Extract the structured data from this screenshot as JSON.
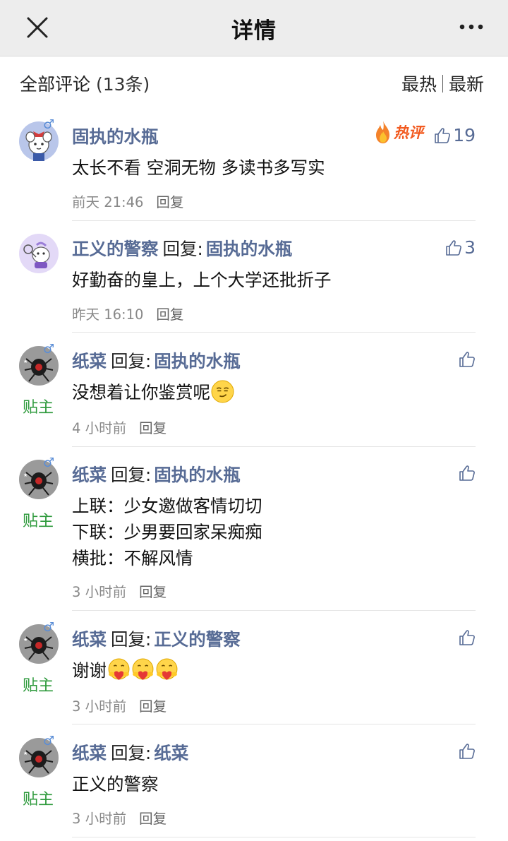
{
  "nav": {
    "title": "详情"
  },
  "list_header": {
    "title": "全部评论",
    "count": "(13条)",
    "sort_hot": "最热",
    "sort_new": "最新"
  },
  "comments": [
    {
      "user": "固执的水瓶",
      "content": "太长不看 空洞无物 多读书多写实",
      "time": "前天 21:46",
      "reply_label": "回复",
      "hot_badge": "热评",
      "likes": "19"
    },
    {
      "user": "正义的警察",
      "reply_word": "回复:",
      "target": "固执的水瓶",
      "content": "好勤奋的皇上，上个大学还批折子",
      "time": "昨天 16:10",
      "reply_label": "回复",
      "likes": "3"
    },
    {
      "user": "纸菜",
      "reply_word": "回复:",
      "target": "固执的水瓶",
      "content": "没想着让你鉴赏呢",
      "time": "4 小时前",
      "reply_label": "回复",
      "badge": "贴主"
    },
    {
      "user": "纸菜",
      "reply_word": "回复:",
      "target": "固执的水瓶",
      "content_lines": [
        "上联：少女邀做客情切切",
        "下联：少男要回家呆痴痴",
        "横批：不解风情"
      ],
      "time": "3 小时前",
      "reply_label": "回复",
      "badge": "贴主"
    },
    {
      "user": "纸菜",
      "reply_word": "回复:",
      "target": "正义的警察",
      "content": "谢谢",
      "time": "3 小时前",
      "reply_label": "回复",
      "badge": "贴主"
    },
    {
      "user": "纸菜",
      "reply_word": "回复:",
      "target": "纸菜",
      "content": "正义的警察",
      "time": "3 小时前",
      "reply_label": "回复",
      "badge": "贴主"
    }
  ],
  "icons": {
    "close": "close-icon",
    "more": "more-icon",
    "like": "thumbs-up-icon",
    "fire": "fire-icon",
    "gender": "male-icon"
  },
  "colors": {
    "link_blue": "#576b95",
    "op_green": "#2e9a3c",
    "hot_orange": "#f25a1f"
  }
}
